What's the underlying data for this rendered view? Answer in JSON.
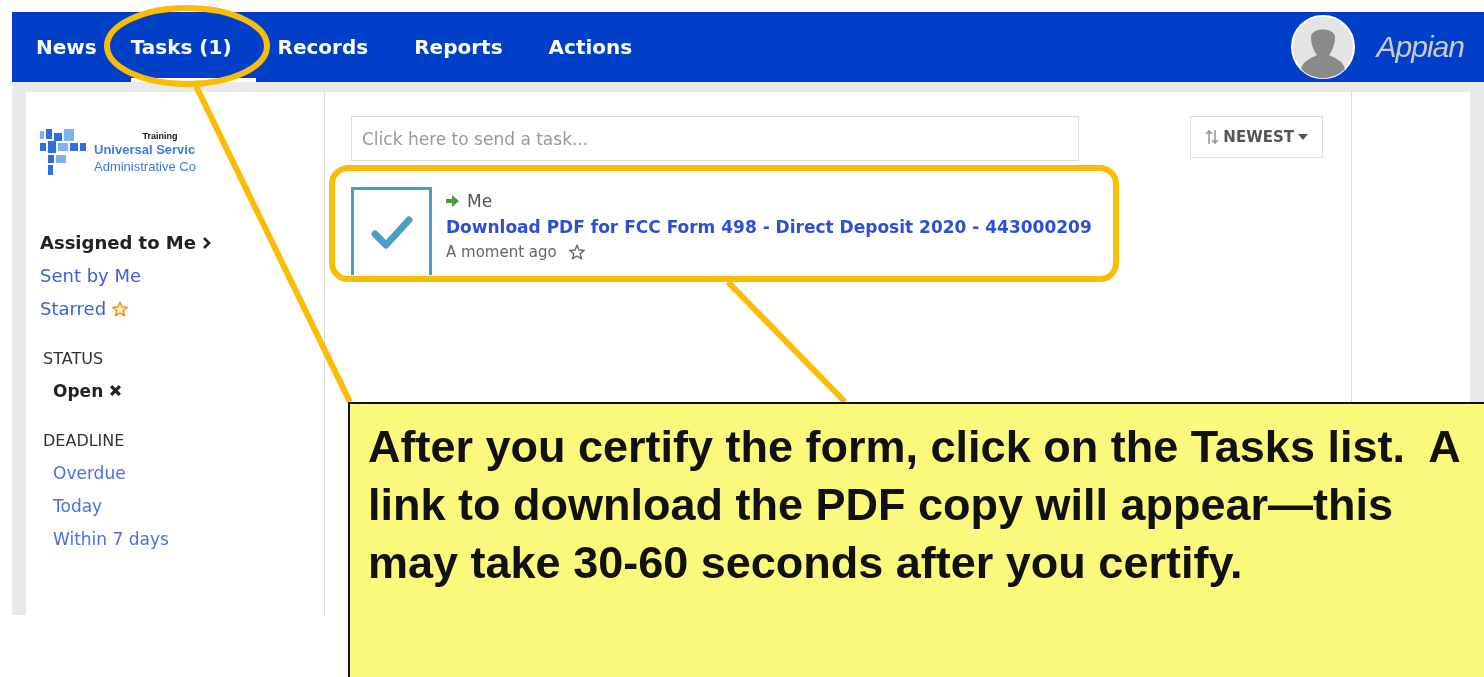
{
  "nav": {
    "tabs": [
      {
        "label": "News",
        "selected": false
      },
      {
        "label": "Tasks (1)",
        "selected": true
      },
      {
        "label": "Records",
        "selected": false
      },
      {
        "label": "Reports",
        "selected": false
      },
      {
        "label": "Actions",
        "selected": false
      }
    ],
    "brand": "Appian"
  },
  "sidebar": {
    "logo": {
      "caption": "Training",
      "line_1": "Universal Servic",
      "line_2": "Administrative Co"
    },
    "views": [
      {
        "label": "Assigned to Me",
        "selected": true,
        "kind": "plain"
      },
      {
        "label": "Sent by Me",
        "selected": false,
        "kind": "plain"
      },
      {
        "label": "Starred",
        "selected": false,
        "kind": "starred"
      }
    ],
    "filters": [
      {
        "heading": "STATUS",
        "options": [
          {
            "label": "Open",
            "active": true
          }
        ]
      },
      {
        "heading": "DEADLINE",
        "options": [
          {
            "label": "Overdue",
            "active": false
          },
          {
            "label": "Today",
            "active": false
          },
          {
            "label": "Within 7 days",
            "active": false
          }
        ]
      }
    ]
  },
  "main": {
    "search": {
      "placeholder": "Click here to send a task..."
    },
    "sort": {
      "label": "NEWEST"
    },
    "tasks": [
      {
        "assignee": "Me",
        "title": "Download PDF for FCC Form 498 - Direct Deposit 2020 - 443000209",
        "time": "A moment ago",
        "completed": true,
        "starred": false
      }
    ]
  },
  "callout": {
    "text": "After you certify the form, click on the Tasks list.  A link to download the PDF copy will appear—this may take 30-60 seconds after you certify."
  }
}
